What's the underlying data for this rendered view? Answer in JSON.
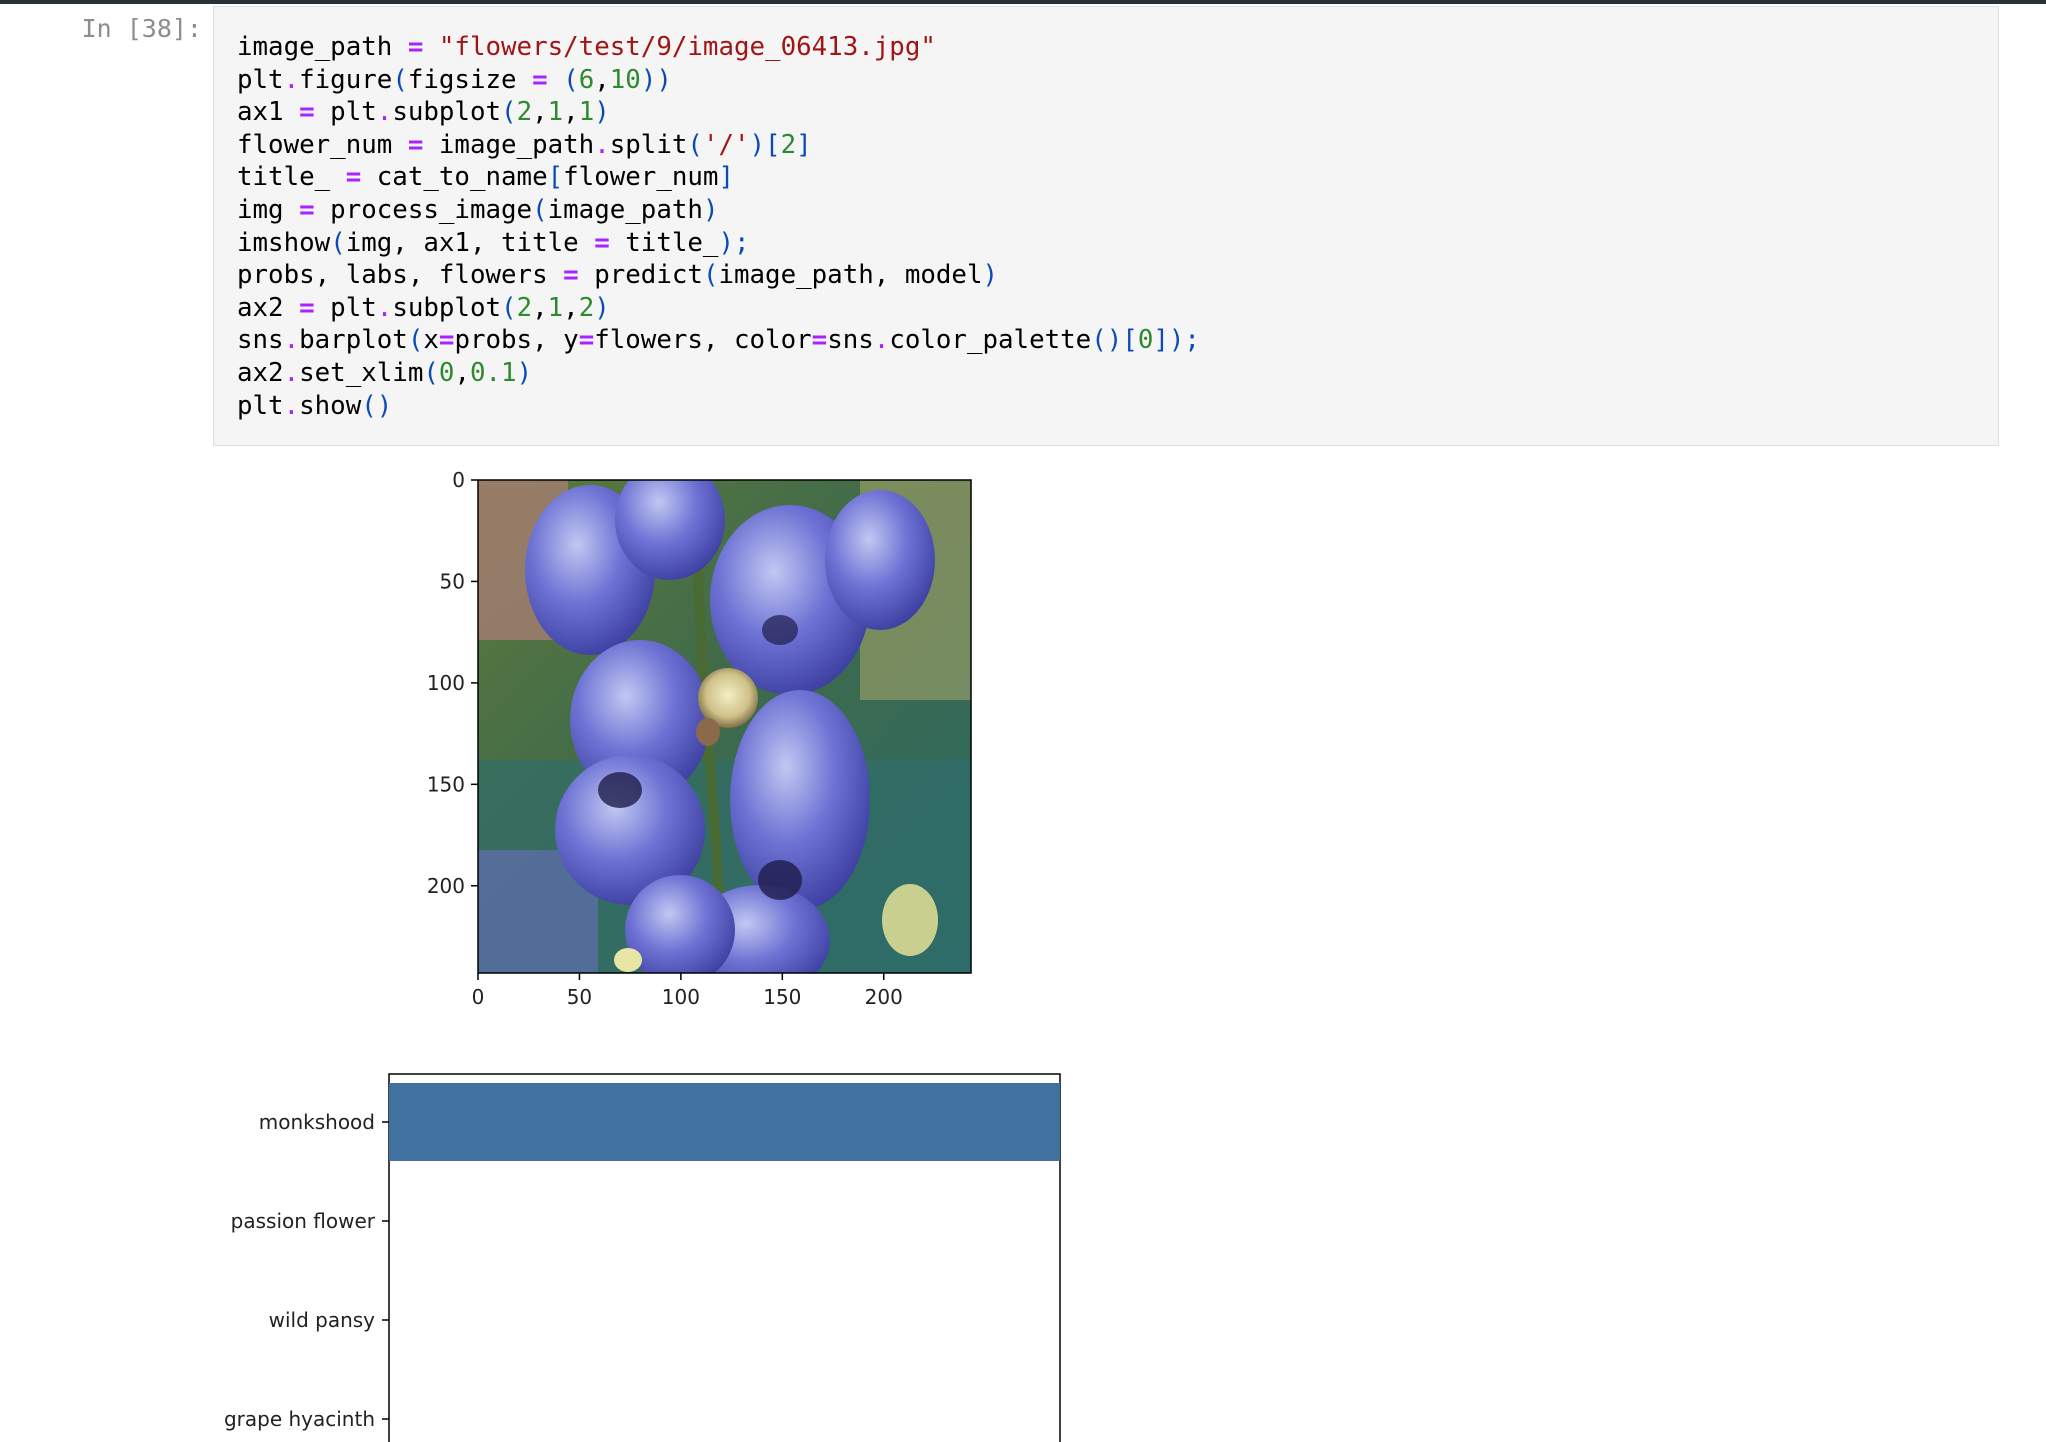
{
  "cell": {
    "prompt": "In [38]:",
    "lines": [
      [
        {
          "t": "image_path "
        },
        {
          "t": "=",
          "c": "op"
        },
        {
          "t": " "
        },
        {
          "t": "\"flowers/test/9/image_06413.jpg\"",
          "c": "str"
        }
      ],
      [
        {
          "t": "plt"
        },
        {
          "t": ".",
          "c": "dot"
        },
        {
          "t": "figure"
        },
        {
          "t": "(",
          "c": "br"
        },
        {
          "t": "figsize "
        },
        {
          "t": "=",
          "c": "op"
        },
        {
          "t": " "
        },
        {
          "t": "(",
          "c": "br"
        },
        {
          "t": "6",
          "c": "num"
        },
        {
          "t": ","
        },
        {
          "t": "10",
          "c": "num"
        },
        {
          "t": "))",
          "c": "br"
        }
      ],
      [
        {
          "t": "ax1 "
        },
        {
          "t": "=",
          "c": "op"
        },
        {
          "t": " plt"
        },
        {
          "t": ".",
          "c": "dot"
        },
        {
          "t": "subplot"
        },
        {
          "t": "(",
          "c": "br"
        },
        {
          "t": "2",
          "c": "num"
        },
        {
          "t": ","
        },
        {
          "t": "1",
          "c": "num"
        },
        {
          "t": ","
        },
        {
          "t": "1",
          "c": "num"
        },
        {
          "t": ")",
          "c": "br"
        }
      ],
      [
        {
          "t": "flower_num "
        },
        {
          "t": "=",
          "c": "op"
        },
        {
          "t": " image_path"
        },
        {
          "t": ".",
          "c": "dot"
        },
        {
          "t": "split"
        },
        {
          "t": "(",
          "c": "br"
        },
        {
          "t": "'/'",
          "c": "str"
        },
        {
          "t": ")[",
          "c": "br"
        },
        {
          "t": "2",
          "c": "num"
        },
        {
          "t": "]",
          "c": "br"
        }
      ],
      [
        {
          "t": "title_ "
        },
        {
          "t": "=",
          "c": "op"
        },
        {
          "t": " cat_to_name"
        },
        {
          "t": "[",
          "c": "br"
        },
        {
          "t": "flower_num"
        },
        {
          "t": "]",
          "c": "br"
        }
      ],
      [
        {
          "t": "img "
        },
        {
          "t": "=",
          "c": "op"
        },
        {
          "t": " process_image"
        },
        {
          "t": "(",
          "c": "br"
        },
        {
          "t": "image_path"
        },
        {
          "t": ")",
          "c": "br"
        }
      ],
      [
        {
          "t": "imshow"
        },
        {
          "t": "(",
          "c": "br"
        },
        {
          "t": "img, ax1, title "
        },
        {
          "t": "=",
          "c": "op"
        },
        {
          "t": " title_"
        },
        {
          "t": ");",
          "c": "br"
        }
      ],
      [
        {
          "t": "probs, labs, flowers "
        },
        {
          "t": "=",
          "c": "op"
        },
        {
          "t": " predict"
        },
        {
          "t": "(",
          "c": "br"
        },
        {
          "t": "image_path, model"
        },
        {
          "t": ")",
          "c": "br"
        }
      ],
      [
        {
          "t": "ax2 "
        },
        {
          "t": "=",
          "c": "op"
        },
        {
          "t": " plt"
        },
        {
          "t": ".",
          "c": "dot"
        },
        {
          "t": "subplot"
        },
        {
          "t": "(",
          "c": "br"
        },
        {
          "t": "2",
          "c": "num"
        },
        {
          "t": ","
        },
        {
          "t": "1",
          "c": "num"
        },
        {
          "t": ","
        },
        {
          "t": "2",
          "c": "num"
        },
        {
          "t": ")",
          "c": "br"
        }
      ],
      [
        {
          "t": "sns"
        },
        {
          "t": ".",
          "c": "dot"
        },
        {
          "t": "barplot"
        },
        {
          "t": "(",
          "c": "br"
        },
        {
          "t": "x"
        },
        {
          "t": "=",
          "c": "op"
        },
        {
          "t": "probs, y"
        },
        {
          "t": "=",
          "c": "op"
        },
        {
          "t": "flowers, color"
        },
        {
          "t": "=",
          "c": "op"
        },
        {
          "t": "sns"
        },
        {
          "t": ".",
          "c": "dot"
        },
        {
          "t": "color_palette"
        },
        {
          "t": "()[",
          "c": "br"
        },
        {
          "t": "0",
          "c": "num"
        },
        {
          "t": "]);",
          "c": "br"
        }
      ],
      [
        {
          "t": "ax2"
        },
        {
          "t": ".",
          "c": "dot"
        },
        {
          "t": "set_xlim"
        },
        {
          "t": "(",
          "c": "br"
        },
        {
          "t": "0",
          "c": "num"
        },
        {
          "t": ","
        },
        {
          "t": "0.1",
          "c": "num"
        },
        {
          "t": ")",
          "c": "br"
        }
      ],
      [
        {
          "t": "plt"
        },
        {
          "t": ".",
          "c": "dot"
        },
        {
          "t": "show"
        },
        {
          "t": "()",
          "c": "br"
        }
      ]
    ]
  },
  "colors": {
    "bar": "#41729f",
    "prompt": "#8d8d8d",
    "string": "#a31515",
    "number": "#2e8a2e",
    "operator": "#aa22ff",
    "bracket": "#0b4bb5"
  },
  "image_plot": {
    "icon": "flower-photo",
    "x_ticks": [
      "0",
      "50",
      "100",
      "150",
      "200"
    ],
    "y_ticks": [
      "0",
      "50",
      "100",
      "150",
      "200"
    ]
  },
  "chart_data": {
    "type": "bar",
    "orientation": "horizontal",
    "categories": [
      "monkshood",
      "passion flower",
      "wild pansy",
      "grape hyacinth"
    ],
    "values": [
      0.1,
      0.0,
      0.0,
      0.0
    ],
    "xlim": [
      0,
      0.1
    ],
    "grid": false,
    "xlabel": "",
    "ylabel": ""
  }
}
